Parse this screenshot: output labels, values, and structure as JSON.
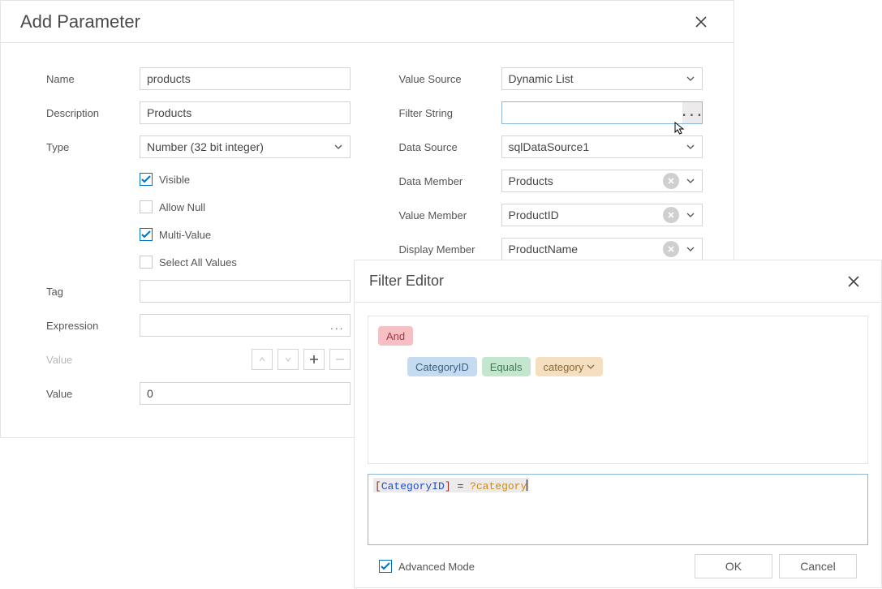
{
  "dialog": {
    "title": "Add Parameter",
    "labels": {
      "name": "Name",
      "description": "Description",
      "type": "Type",
      "visible": "Visible",
      "allow_null": "Allow Null",
      "multi_value": "Multi-Value",
      "select_all": "Select All Values",
      "tag": "Tag",
      "expression": "Expression",
      "value_count": "Value",
      "value": "Value",
      "value_source": "Value Source",
      "filter_string": "Filter String",
      "data_source": "Data Source",
      "data_member": "Data Member",
      "value_member": "Value Member",
      "display_member": "Display Member"
    },
    "values": {
      "name": "products",
      "description": "Products",
      "type": "Number (32 bit integer)",
      "visible": true,
      "allow_null": false,
      "multi_value": true,
      "select_all": false,
      "tag": "",
      "expression": "",
      "expr_ellipsis": "...",
      "value": "0",
      "value_source": "Dynamic List",
      "filter_string": "",
      "filter_ellipsis": "...",
      "data_source": "sqlDataSource1",
      "data_member": "Products",
      "value_member": "ProductID",
      "display_member": "ProductName"
    }
  },
  "filter_editor": {
    "title": "Filter Editor",
    "group_op": "And",
    "condition": {
      "field": "CategoryID",
      "operator": "Equals",
      "value": "category"
    },
    "expression_raw": {
      "open": "[",
      "field": "CategoryID",
      "close": "]",
      "eq": " = ",
      "qmark": "?",
      "param": "category"
    },
    "advanced_mode_label": "Advanced Mode",
    "advanced_mode_checked": true,
    "ok": "OK",
    "cancel": "Cancel"
  }
}
